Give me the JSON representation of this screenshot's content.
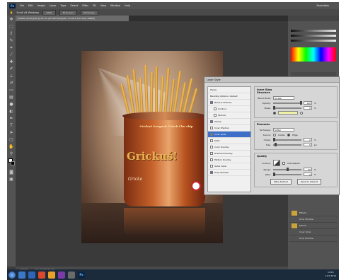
{
  "app": {
    "logo": "Ps",
    "menu": [
      "File",
      "Edit",
      "Image",
      "Layer",
      "Type",
      "Select",
      "Filter",
      "3D",
      "View",
      "Window",
      "Help"
    ],
    "workspace_label": "Essentials"
  },
  "options_bar": {
    "checkbox_label": "Scroll All Windows",
    "buttons": [
      "100%",
      "Fit Screen",
      "Fill Screen"
    ]
  },
  "document": {
    "tab_title": "pretzel_dovolj.psd @ 16.7% (Grickoš Gengosh, Conisch Chu ship, RGB/8)"
  },
  "artwork": {
    "can_top_text": "Grickuš Gengosh Crisch Chu ship",
    "can_logo": "Grickuš!",
    "can_bottom_text": "Gricke"
  },
  "status": {
    "zoom": "16.67%",
    "doc_size": "Doc: 8.0M/134.5M"
  },
  "dialog": {
    "title": "Layer Style",
    "styles_header": "Styles",
    "styles": [
      {
        "label": "Blending Options: Default",
        "checked": false,
        "checkbox": false,
        "selected": false,
        "indent": false
      },
      {
        "label": "Bevel & Emboss",
        "checked": true,
        "checkbox": true,
        "selected": false,
        "indent": false
      },
      {
        "label": "Contour",
        "checked": false,
        "checkbox": true,
        "selected": false,
        "indent": true
      },
      {
        "label": "Texture",
        "checked": false,
        "checkbox": true,
        "selected": false,
        "indent": true
      },
      {
        "label": "Stroke",
        "checked": true,
        "checkbox": true,
        "selected": false,
        "indent": false
      },
      {
        "label": "Inner Shadow",
        "checked": false,
        "checkbox": true,
        "selected": false,
        "indent": false
      },
      {
        "label": "Inner Glow",
        "checked": true,
        "checkbox": true,
        "selected": true,
        "indent": false
      },
      {
        "label": "Satin",
        "checked": false,
        "checkbox": true,
        "selected": false,
        "indent": false
      },
      {
        "label": "Color Overlay",
        "checked": false,
        "checkbox": true,
        "selected": false,
        "indent": false
      },
      {
        "label": "Gradient Overlay",
        "checked": false,
        "checkbox": true,
        "selected": false,
        "indent": false
      },
      {
        "label": "Pattern Overlay",
        "checked": false,
        "checkbox": true,
        "selected": false,
        "indent": false
      },
      {
        "label": "Outer Glow",
        "checked": false,
        "checkbox": true,
        "selected": false,
        "indent": false
      },
      {
        "label": "Drop Shadow",
        "checked": true,
        "checkbox": true,
        "selected": false,
        "indent": false
      }
    ],
    "panel_title": "Inner Glow",
    "structure": {
      "title": "Structure",
      "blend_mode_label": "Blend Mode:",
      "blend_mode_value": "Screen",
      "opacity_label": "Opacity:",
      "opacity_value": "100",
      "noise_label": "Noise:",
      "noise_value": "0",
      "unit_percent": "%"
    },
    "elements": {
      "title": "Elements",
      "technique_label": "Technique:",
      "technique_value": "Softer",
      "source_label": "Source:",
      "source_center": "Center",
      "source_edge": "Edge",
      "choke_label": "Choke:",
      "choke_value": "0",
      "size_label": "Size:",
      "size_value": "5",
      "unit_px": "px"
    },
    "quality": {
      "title": "Quality",
      "contour_label": "Contour:",
      "antialiased_label": "Anti-aliased",
      "range_label": "Range:",
      "range_value": "50",
      "jitter_label": "Jitter:",
      "jitter_value": "0"
    },
    "make_default": "Make Default",
    "reset_default": "Reset to Default"
  },
  "layers": [
    {
      "label": "Effects"
    },
    {
      "label": "Drop Shadow"
    },
    {
      "label": "Effects"
    },
    {
      "label": "Inner Glow"
    },
    {
      "label": "Drop Shadow"
    }
  ],
  "clock": {
    "time": "14:15",
    "date": "12.5.2014"
  }
}
